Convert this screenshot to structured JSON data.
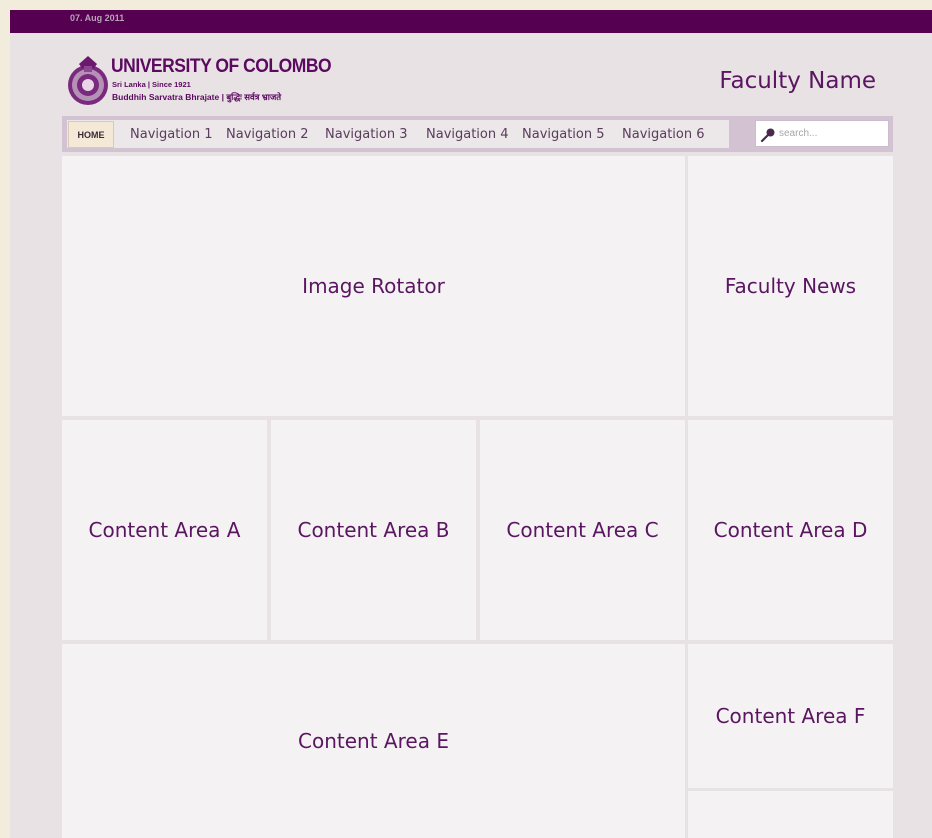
{
  "header": {
    "date": "07. Aug 2011",
    "university": "UNIVERSITY OF COLOMBO",
    "tagline": "Sri Lanka | Since 1921",
    "motto": "Buddhih Sarvatra Bhrajate | बुद्धिः सर्वत्र भ्राजते",
    "faculty_name": "Faculty Name"
  },
  "nav": {
    "home": "HOME",
    "items": [
      "Navigation 1",
      "Navigation 2",
      "Navigation 3",
      "Navigation 4",
      "Navigation 5",
      "Navigation 6"
    ]
  },
  "search": {
    "placeholder": "search..."
  },
  "panels": {
    "image_rotator": "Image Rotator",
    "faculty_news": "Faculty News",
    "area_a": "Content Area A",
    "area_b": "Content Area B",
    "area_c": "Content Area C",
    "area_d": "Content Area D",
    "area_e": "Content Area E",
    "area_f": "Content Area F"
  },
  "colors": {
    "top_bar": "#560052",
    "brand_purple": "#5a1660",
    "nav_bar": "#d3c3d2",
    "panel_bg": "#f4f2f3",
    "page_bg": "#e8e2e5",
    "outer_bg": "#f1ecdc"
  }
}
